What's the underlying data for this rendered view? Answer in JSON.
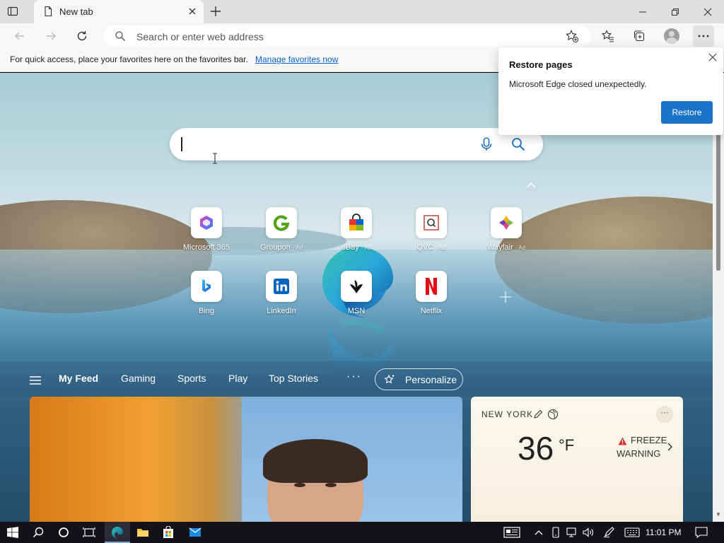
{
  "browser": {
    "tab_title": "New tab",
    "address_placeholder": "Search or enter web address",
    "favorites_bar_message": "For quick access, place your favorites here on the favorites bar.",
    "favorites_bar_link": "Manage favorites now"
  },
  "popup": {
    "title": "Restore pages",
    "message": "Microsoft Edge closed unexpectedly.",
    "button": "Restore"
  },
  "quick_links": [
    {
      "label": "Microsoft 365",
      "ad": "",
      "icon": "microsoft-365-icon"
    },
    {
      "label": "Groupon",
      "ad": "· Ad",
      "icon": "groupon-icon"
    },
    {
      "label": "eBay",
      "ad": "· Ad",
      "icon": "ebay-icon"
    },
    {
      "label": "QVC",
      "ad": "· Ad",
      "icon": "qvc-icon"
    },
    {
      "label": "Wayfair",
      "ad": "· Ad",
      "icon": "wayfair-icon"
    },
    {
      "label": "Bing",
      "ad": "",
      "icon": "bing-icon"
    },
    {
      "label": "LinkedIn",
      "ad": "",
      "icon": "linkedin-icon"
    },
    {
      "label": "MSN",
      "ad": "",
      "icon": "msn-icon"
    },
    {
      "label": "Netflix",
      "ad": "",
      "icon": "netflix-icon"
    }
  ],
  "feed": {
    "tabs": [
      "My Feed",
      "Gaming",
      "Sports",
      "Play",
      "Top Stories"
    ],
    "more": "···",
    "personalize": "Personalize"
  },
  "weather": {
    "city": "NEW YORK",
    "temperature": "36",
    "unit": "°F",
    "warning_line1": "FREEZE",
    "warning_line2": "WARNING",
    "more": "···"
  },
  "taskbar": {
    "time": "11:01 PM"
  },
  "colors": {
    "accent": "#1a73c9",
    "link": "#0b62c4",
    "warning": "#d13438",
    "netflix": "#e50914",
    "linkedin": "#0a66c2"
  }
}
